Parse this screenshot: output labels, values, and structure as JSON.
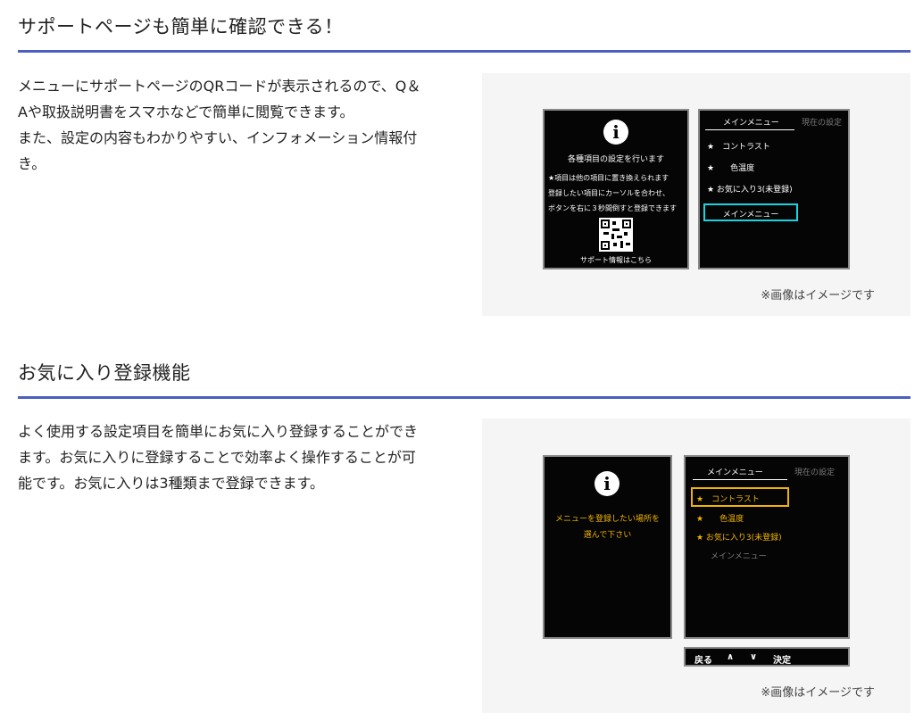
{
  "section1": {
    "title": "サポートページも簡単に確認できる！",
    "body": [
      "メニューにサポートページのQRコードが表示されるので、Q＆",
      "Aや取扱説明書をスマホなどで簡単に閲覧できます。",
      "また、設定の内容もわかりやすい、インフォメーション情報付",
      "き。"
    ],
    "caption": "※画像はイメージです",
    "left_screen": {
      "info_icon": "i",
      "line1": "各種項目の設定を行います",
      "line2": "★項目は他の項目に置き換えられます",
      "line3": "登録したい項目にカーソルを合わせ、",
      "line4": "ボタンを右に３秒間倒すと登録できます",
      "footer": "サポート情報はこちら"
    },
    "right_screen": {
      "header": "メインメニュー",
      "header_dim": "現在の設定",
      "items": [
        "★　コントラスト",
        "★　　色温度",
        "★ お気に入り3(未登録)"
      ],
      "selected": "メインメニュー"
    }
  },
  "section2": {
    "title": "お気に入り登録機能",
    "body": [
      "よく使用する設定項目を簡単にお気に入り登録することができ",
      "ます。お気に入りに登録することで効率よく操作することが可",
      "能です。お気に入りは3種類まで登録できます。"
    ],
    "caption": "※画像はイメージです",
    "left_screen": {
      "info_icon": "i",
      "line1": "メニューを登録したい場所を",
      "line2": "選んで下さい"
    },
    "right_screen": {
      "header": "メインメニュー",
      "header_dim": "現在の設定",
      "selected": "★　コントラスト",
      "items": [
        "★　　色温度",
        "★ お気に入り3(未登録)"
      ],
      "dim_item": "メインメニュー"
    },
    "navbar": {
      "back": "戻る",
      "up": "∧",
      "down": "∨",
      "ok": "決定"
    }
  },
  "colors": {
    "accent": "#4a5fbf",
    "cyan": "#1bd3e0",
    "yellow": "#f0b400"
  }
}
